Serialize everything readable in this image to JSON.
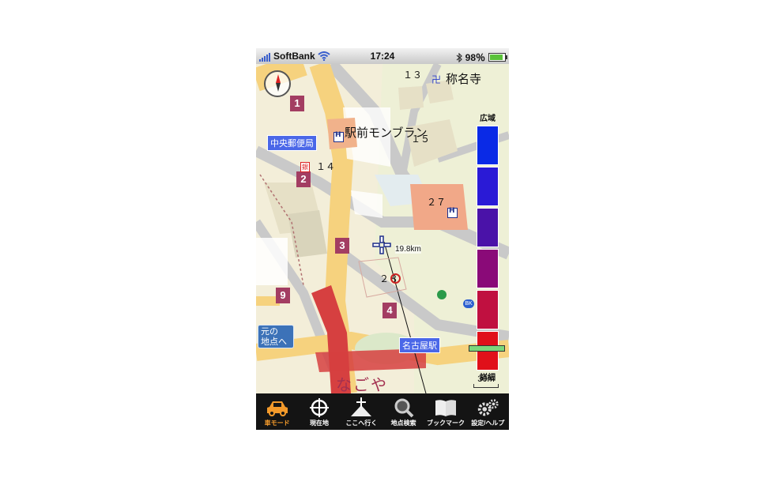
{
  "status_bar": {
    "carrier": "SoftBank",
    "time": "17:24",
    "battery": "98％",
    "battery_level": 0.98
  },
  "map": {
    "labels": {
      "temple": "称名寺",
      "building": "駅前モンブラン",
      "block_13": "１３",
      "block_15": "１５",
      "block_14": "１４",
      "block_27": "２７",
      "block_28": "２８",
      "station_area": "なごや"
    },
    "tags": {
      "post_office": "中央郵便局",
      "station": "名古屋駅"
    },
    "exits": [
      "1",
      "2",
      "3",
      "4",
      "9"
    ],
    "distance": "19.8km",
    "back_button": "元の\n地点へ",
    "zoom": {
      "top_label": "広域",
      "bottom_label": "詳細",
      "scale": "30m",
      "colors": [
        "#0a2ae6",
        "#2a1ad6",
        "#4a12a8",
        "#8a0a78",
        "#c01040",
        "#e0101a"
      ]
    },
    "icons": {
      "temple": "manji-icon",
      "compass": "compass-icon",
      "poi": "building-icon",
      "cursor": "crosshair-icon"
    }
  },
  "tab_bar": {
    "active_color": "#f39a2b",
    "tabs": [
      {
        "label": "車モード",
        "icon": "car-icon"
      },
      {
        "label": "現在地",
        "icon": "crosshair-icon"
      },
      {
        "label": "ここへ行く",
        "icon": "go-here-icon"
      },
      {
        "label": "地点検索",
        "icon": "search-icon"
      },
      {
        "label": "ブックマーク",
        "icon": "book-icon"
      },
      {
        "label": "設定/ヘルプ",
        "icon": "gear-icon"
      }
    ]
  }
}
